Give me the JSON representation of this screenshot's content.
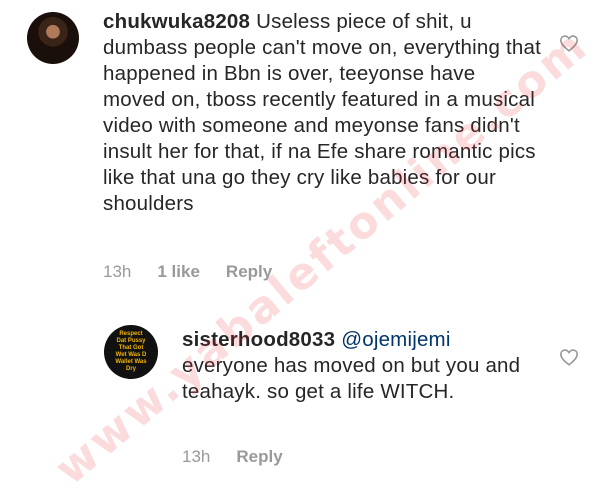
{
  "main_comment": {
    "username": "chukwuka8208",
    "text": "Useless piece of shit, u dumbass people can't move on, everything that happened in Bbn is over, teeyonse have moved on, tboss recently featured in a musical video with someone and meyonse fans didn't insult her for that,  if na Efe share romantic pics like that una go they cry like babies for our shoulders",
    "time": "13h",
    "likes": "1 like",
    "reply_label": "Reply",
    "like_icon": "heart-outline-icon"
  },
  "reply_comment": {
    "username": "sisterhood8033",
    "mention": "@ojemijemi",
    "text": "everyone has moved on but you and teahayk. so get a life WITCH.",
    "time": "13h",
    "reply_label": "Reply",
    "avatar_text": "Respect Dat Pussy That Got Wet Was D Wallet Was Dry",
    "like_icon": "heart-outline-icon"
  },
  "watermark": "www.yabaleftonline.com",
  "colors": {
    "text": "#262626",
    "meta": "#999999",
    "mention": "#003569",
    "watermark": "#e61e1e"
  }
}
